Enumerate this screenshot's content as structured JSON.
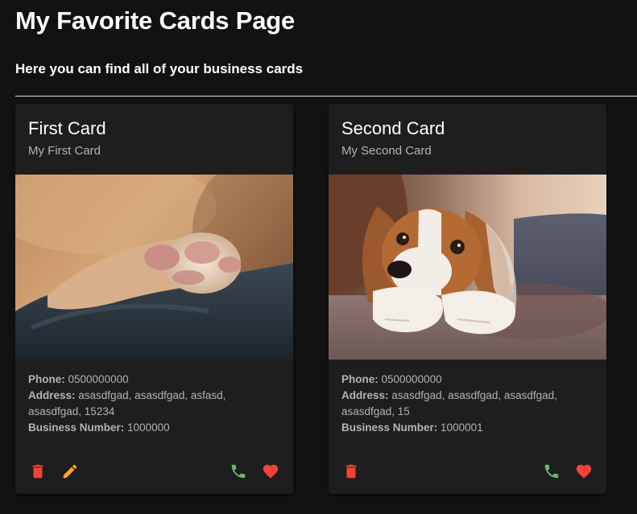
{
  "page": {
    "title": "My Favorite Cards Page",
    "subtitle": "Here you can find all of your business cards"
  },
  "colors": {
    "background": "#121212",
    "card": "#1e1e1e",
    "delete": "#f44336",
    "edit": "#ffa726",
    "call": "#66bb6a",
    "favorite": "#f44336"
  },
  "cards": [
    {
      "title": "First Card",
      "subtitle": "My First Card",
      "image_icon": "cat-paw-photo",
      "phone_label": "Phone:",
      "phone": "0500000000",
      "address_label": "Address:",
      "address": "asasdfgad, asasdfgad, asfasd, asasdfgad, 15234",
      "business_number_label": "Business Number:",
      "business_number": "1000000",
      "actions": [
        "delete-icon",
        "edit-icon",
        "phone-icon",
        "heart-icon"
      ]
    },
    {
      "title": "Second Card",
      "subtitle": "My Second Card",
      "image_icon": "dog-photo",
      "phone_label": "Phone:",
      "phone": "0500000000",
      "address_label": "Address:",
      "address": "asasdfgad, asasdfgad, asasdfgad, asasdfgad, 15",
      "business_number_label": "Business Number:",
      "business_number": "1000001",
      "actions": [
        "delete-icon",
        "phone-icon",
        "heart-icon"
      ]
    }
  ]
}
